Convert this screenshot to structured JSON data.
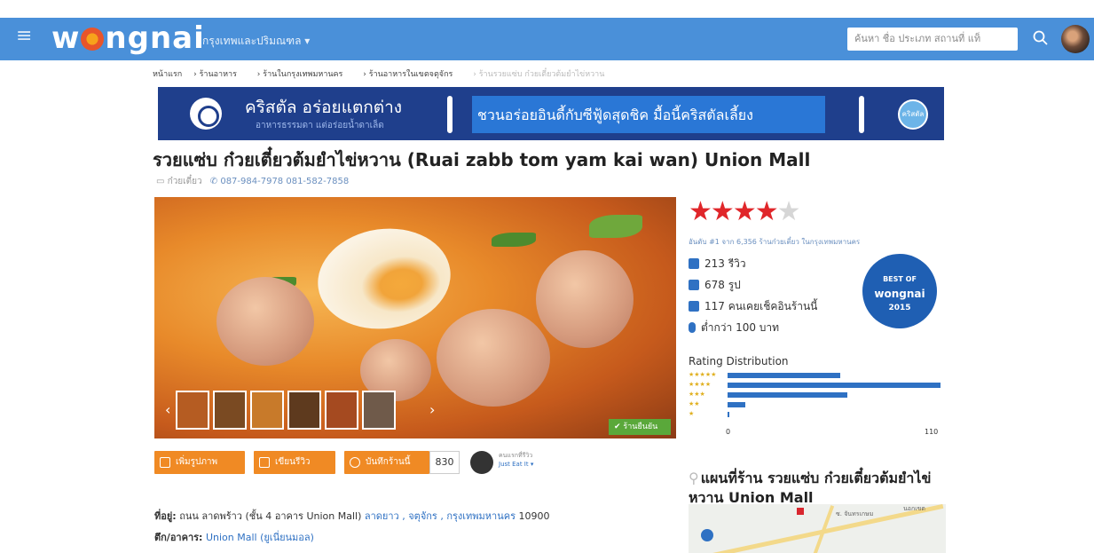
{
  "header": {
    "menu_icon": "hamburger-icon",
    "logo": "wongnai",
    "city": "กรุงเทพและปริมณฑล",
    "search_placeholder": "ค้นหา ชื่อ ประเภท สถานที่ แท็",
    "search_icon": "search-icon"
  },
  "breadcrumb": [
    "หน้าแรก",
    "ร้านอาหาร",
    "ร้านในกรุงเทพมหานคร",
    "ร้านอาหารในเขตจตุจักร",
    "ร้านรวยแซ่บ ก๋วยเตี๋ยวต้มยำไข่หวาน"
  ],
  "banner": {
    "headline": "คริสตัล อร่อยแตกต่าง",
    "subline": "อาหารธรรมดา แต่อร่อยน้ำดาเล็ด",
    "promo": "ชวนอร่อยอินดี้กับซีฟู้ดสุดชิค มื้อนี้คริสตัลเลี้ยง",
    "badge": "คริสตัล"
  },
  "restaurant": {
    "title": "รวยแซ่บ ก๋วยเตี๋ยวต้มยำไข่หวาน (Ruai zabb tom yam kai wan) Union Mall",
    "category": "ก๋วยเตี๋ยว",
    "phones": "087-984-7978 081-582-7858",
    "verified_label": "ร้านยืนยัน"
  },
  "rating": {
    "stars": 4,
    "max": 5,
    "rank_text": "อันดับ #1 จาก 6,356 ร้านก๋วยเตี๋ยว ในกรุงเทพมหานคร",
    "reviews": "213 รีวิว",
    "photos": "678 รูป",
    "checkins": "117 คนเคยเช็คอินร้านนี้",
    "price": "ต่ำกว่า 100 บาท"
  },
  "best_of": {
    "line1": "BEST OF",
    "line2": "wongnai",
    "line3": "2015"
  },
  "rating_distribution": {
    "title": "Rating Distribution",
    "labels": [
      "★★★★★",
      "★★★★",
      "★★★",
      "★★",
      "★"
    ],
    "values": [
      58,
      110,
      62,
      9,
      1
    ],
    "axis_min": "0",
    "axis_max": "110"
  },
  "actions": {
    "add_photo": "เพิ่มรูปภาพ",
    "write_review": "เขียนรีวิว",
    "bookmark": "บันทึกร้านนี้",
    "bookmark_count": "830",
    "checker_label": "คนแรกที่รีวิว",
    "checker_name": "Just Eat It ▾"
  },
  "address": {
    "label": "ที่อยู่:",
    "text": "ถนน ลาดพร้าว (ชั้น 4 อาคาร Union Mall)",
    "links": "ลาดยาว , จตุจักร , กรุงเทพมหานคร",
    "zip": "10900",
    "building_label": "ตึก/อาคาร:",
    "building": "Union Mall (ยูเนี่ยนมอล)"
  },
  "map": {
    "title": "แผนที่ร้าน รวยแซ่บ ก๋วยเตี๋ยวต้มยำไข่หวาน Union Mall",
    "road1": "ซ. จันทรเกษม",
    "road2": "นอกเขต"
  }
}
